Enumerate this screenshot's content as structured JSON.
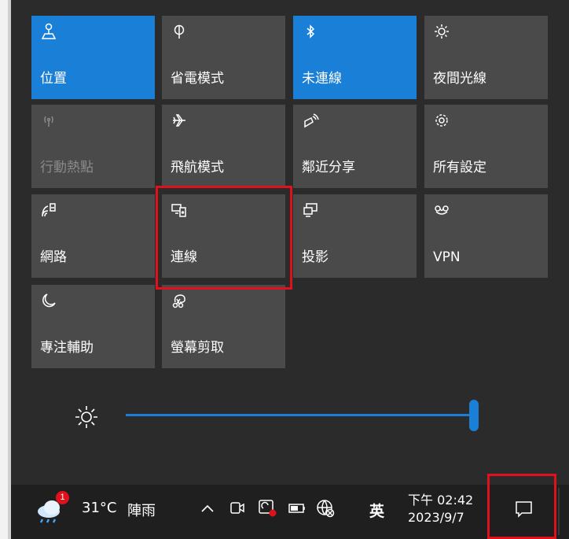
{
  "quick_actions": [
    {
      "id": "location",
      "label": "位置",
      "icon": "location-icon",
      "state": "on"
    },
    {
      "id": "battery-saver",
      "label": "省電模式",
      "icon": "battery-saver-icon",
      "state": "off"
    },
    {
      "id": "bluetooth",
      "label": "未連線",
      "icon": "bluetooth-icon",
      "state": "on"
    },
    {
      "id": "night-light",
      "label": "夜間光線",
      "icon": "night-light-icon",
      "state": "off"
    },
    {
      "id": "mobile-hotspot",
      "label": "行動熱點",
      "icon": "mobile-hotspot-icon",
      "state": "disabled"
    },
    {
      "id": "airplane-mode",
      "label": "飛航模式",
      "icon": "airplane-icon",
      "state": "off"
    },
    {
      "id": "nearby-sharing",
      "label": "鄰近分享",
      "icon": "nearby-share-icon",
      "state": "off"
    },
    {
      "id": "all-settings",
      "label": "所有設定",
      "icon": "gear-icon",
      "state": "off"
    },
    {
      "id": "network",
      "label": "網路",
      "icon": "network-icon",
      "state": "off"
    },
    {
      "id": "connect",
      "label": "連線",
      "icon": "connect-icon",
      "state": "off"
    },
    {
      "id": "project",
      "label": "投影",
      "icon": "project-icon",
      "state": "off"
    },
    {
      "id": "vpn",
      "label": "VPN",
      "icon": "vpn-icon",
      "state": "off"
    },
    {
      "id": "focus-assist",
      "label": "專注輔助",
      "icon": "moon-icon",
      "state": "off"
    },
    {
      "id": "screen-snip",
      "label": "螢幕剪取",
      "icon": "snip-icon",
      "state": "off"
    }
  ],
  "brightness": {
    "icon": "brightness-icon",
    "level": 1.0
  },
  "taskbar": {
    "weather": {
      "temp": "31°C",
      "desc": "陣雨",
      "badge": "1",
      "icon": "weather-icon"
    },
    "ime_label": "英",
    "clock": {
      "time": "下午 02:42",
      "date": "2023/9/7"
    }
  },
  "colors": {
    "accent": "#1a7fd6",
    "tile": "#4a4a4a",
    "highlight": "#e0111c"
  }
}
